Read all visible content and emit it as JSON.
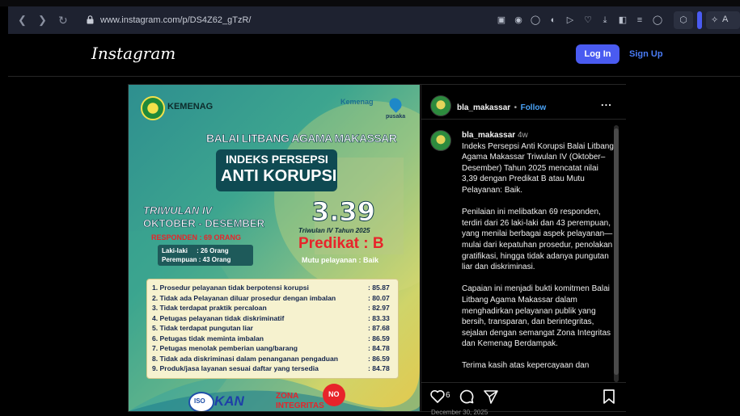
{
  "browser": {
    "url": "www.instagram.com/p/DS4Z62_gTzR/",
    "ext_label": "A"
  },
  "header": {
    "logo": "Instagram",
    "login": "Log In",
    "signup": "Sign Up"
  },
  "poster": {
    "kemenag": "KEMENAG",
    "brand_kemenag": "Kemenag",
    "pusaka": "pusaka",
    "balai": "BALAI LITBANG AGAMA MAKASSAR",
    "indeks": "INDEKS PERSEPSI",
    "anti": "ANTI KORUPSI",
    "triwulan": "TRIWULAN IV",
    "period": "OKTOBER - DESEMBER",
    "responden": "RESPONDEN : 69 ORANG",
    "laki": "Laki-laki     : 26 Orang",
    "perempuan": "Perempuan : 43 Orang",
    "score": "3.39",
    "tri_year": "Triwulan IV Tahun 2025",
    "predikat": "Predikat : B",
    "mutu": "Mutu pelayanan : Baik",
    "items": [
      {
        "label": "1. Prosedur pelayanan tidak berpotensi korupsi",
        "value": ": 85.87"
      },
      {
        "label": "2. Tidak ada Pelayanan diluar prosedur dengan imbalan",
        "value": ": 80.07"
      },
      {
        "label": "3. Tidak terdapat praktik percaloan",
        "value": ": 82.97"
      },
      {
        "label": "4. Petugas pelayanan tidak diskriminatif",
        "value": ": 83.33"
      },
      {
        "label": "5. Tidak terdapat pungutan liar",
        "value": ": 87.68"
      },
      {
        "label": "6. Petugas tidak meminta imbalan",
        "value": ": 86.59"
      },
      {
        "label": "7. Petugas menolak pemberian uang/barang",
        "value": ": 84.78"
      },
      {
        "label": "8. Tidak ada diskriminasi dalam penanganan pengaduan",
        "value": ": 86.59"
      },
      {
        "label": "9. Produk/jasa layanan sesuai daftar yang tersedia",
        "value": ": 84.78"
      }
    ],
    "iso": "ISO",
    "kan": "KAN",
    "zona1": "ZONA",
    "zona2": "INTEGRITAS",
    "stamp": "NO"
  },
  "side": {
    "username": "bla_makassar",
    "follow": "Follow",
    "more": "...",
    "caption_user": "bla_makassar",
    "caption_time": "4w",
    "paragraphs": [
      "Indeks Persepsi Anti Korupsi Balai Litbang Agama Makassar Triwulan IV (Oktober–Desember) Tahun 2025 mencatat nilai 3,39 dengan Predikat B atau Mutu Pelayanan: Baik.",
      "Penilaian ini melibatkan 69 responden, terdiri dari 26 laki-laki dan 43 perempuan, yang menilai berbagai aspek pelayanan—mulai dari kepatuhan prosedur, penolakan gratifikasi, hingga tidak adanya pungutan liar dan diskriminasi.",
      "Capaian ini menjadi bukti komitmen Balai Litbang Agama Makassar dalam menghadirkan pelayanan publik yang bersih, transparan, dan berintegritas, sejalan dengan semangat Zona Integritas dan Kemenag Berdampak.",
      "Terima kasih atas kepercayaan dan"
    ],
    "likes": "6",
    "date": "December 30, 2025"
  }
}
